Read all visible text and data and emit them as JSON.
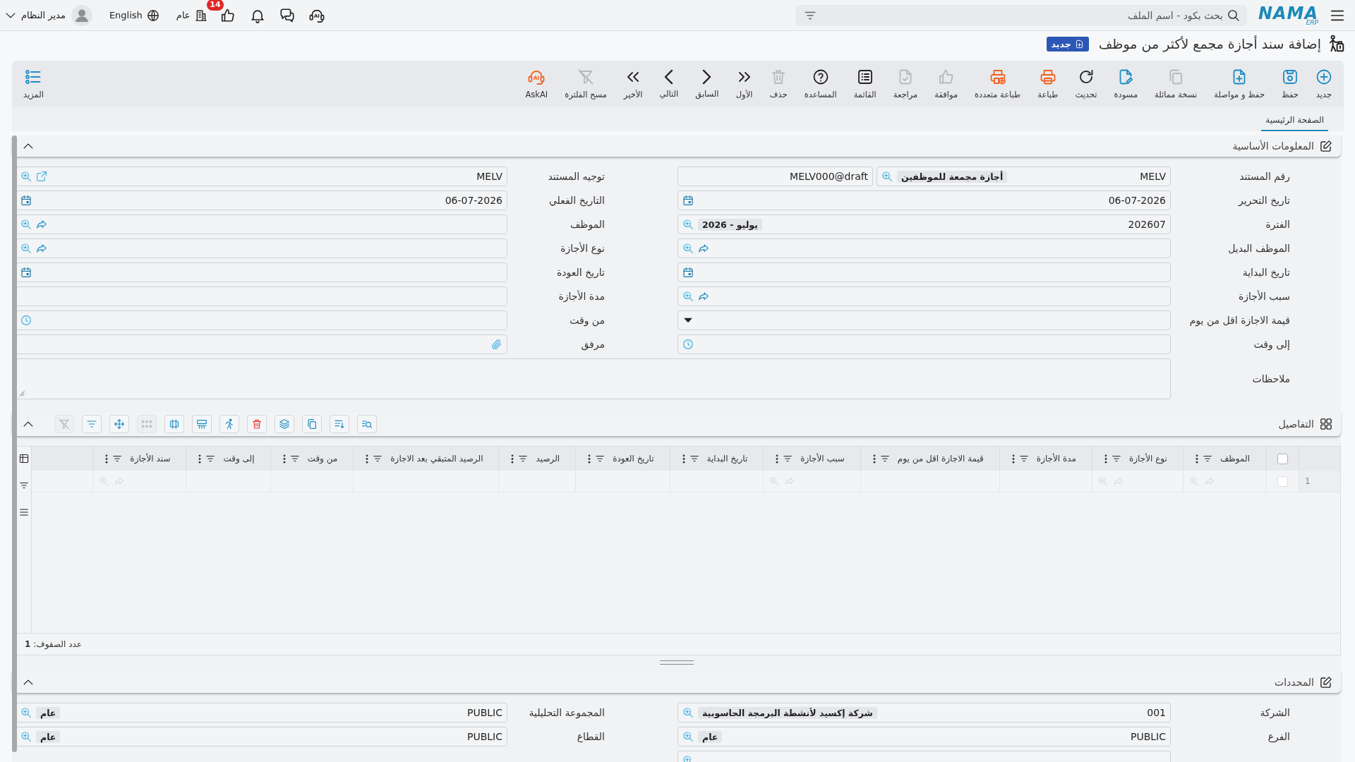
{
  "top_bar": {
    "logo": {
      "text": "NAMA",
      "sub": "ERP"
    },
    "search": {
      "placeholder": "بحث بكود - اسم الملف"
    },
    "assistant": "AI",
    "approvals_count": "14",
    "branch": "عام",
    "language": "English",
    "user": "مدير النظام"
  },
  "page_title": {
    "text": "إضافة سند أجازة مجمع لأكثر من موظف",
    "status": "جديد"
  },
  "toolbar": {
    "buttons": [
      {
        "kind": "new",
        "label": "جديد",
        "disabled": false
      },
      {
        "kind": "save",
        "label": "حفظ",
        "disabled": false
      },
      {
        "kind": "savecontinue",
        "label": "حفظ و مواصلة",
        "disabled": false
      },
      {
        "kind": "duplicate",
        "label": "نسخة مماثلة",
        "disabled": true
      },
      {
        "kind": "draft",
        "label": "مسودة",
        "disabled": false
      },
      {
        "kind": "refresh",
        "label": "تحديث",
        "disabled": false
      },
      {
        "kind": "print",
        "label": "طباعة",
        "disabled": false
      },
      {
        "kind": "multiprint",
        "label": "طباعة متعددة",
        "disabled": false
      },
      {
        "kind": "approve",
        "label": "موافقة",
        "disabled": true
      },
      {
        "kind": "review",
        "label": "مراجعة",
        "disabled": true
      },
      {
        "kind": "list",
        "label": "القائمة",
        "disabled": false
      },
      {
        "kind": "help",
        "label": "المساعدة",
        "disabled": false
      },
      {
        "kind": "delete",
        "label": "حذف",
        "disabled": true
      },
      {
        "kind": "first",
        "label": "الأول",
        "disabled": false
      },
      {
        "kind": "previous",
        "label": "السابق",
        "disabled": false
      },
      {
        "kind": "next",
        "label": "التالي",
        "disabled": false
      },
      {
        "kind": "last",
        "label": "الأخير",
        "disabled": false
      },
      {
        "kind": "clearfilter",
        "label": "مسح الفلترة",
        "disabled": true
      },
      {
        "kind": "askai",
        "label": "AskAI",
        "badge": "AI",
        "disabled": false
      }
    ],
    "more": "المزيد"
  },
  "tabs": [
    {
      "label": "الصفحة الرئيسية",
      "selected": true
    }
  ],
  "basic_info": {
    "title": "المعلومات الأساسية",
    "expanded": true,
    "fields": [
      {
        "label": "رقم المستند",
        "kind": "docnumber",
        "value": "MELV",
        "chip": "أجازة مجمعة للموظفين",
        "code": "MELV000@draft"
      },
      {
        "label": "توجيه المستند",
        "kind": "route",
        "value": "MELV"
      },
      {
        "label": "تاريخ التحرير",
        "kind": "date",
        "value": "06-07-2026"
      },
      {
        "label": "التاريخ الفعلي",
        "kind": "date",
        "value": "06-07-2026"
      },
      {
        "label": "الفترة",
        "kind": "lookup",
        "value": "202607",
        "chip": "يوليو - 2026"
      },
      {
        "label": "الموظف",
        "kind": "reference"
      },
      {
        "label": "الموظف البديل",
        "kind": "reference"
      },
      {
        "label": "نوع الأجازة",
        "kind": "reference"
      },
      {
        "label": "تاريخ البداية",
        "kind": "date"
      },
      {
        "label": "تاريخ العودة",
        "kind": "date"
      },
      {
        "label": "سبب الأجازة",
        "kind": "reference"
      },
      {
        "label": "مدة الأجازة",
        "kind": "text"
      },
      {
        "label": "قيمة الاجازة اقل من يوم",
        "kind": "select"
      },
      {
        "label": "من وقت",
        "kind": "time"
      },
      {
        "label": "إلى وقت",
        "kind": "time"
      },
      {
        "label": "مرفق",
        "kind": "attachment"
      },
      {
        "label": "ملاحظات",
        "kind": "textarea"
      }
    ]
  },
  "details": {
    "title": "التفاصيل",
    "expanded": true,
    "tools": [
      {
        "kind": "searchlist",
        "disabled": false
      },
      {
        "kind": "listarrow",
        "disabled": false
      },
      {
        "kind": "copy",
        "disabled": false
      },
      {
        "kind": "layers",
        "disabled": false
      },
      {
        "kind": "delete",
        "disabled": false
      },
      {
        "kind": "run",
        "disabled": false
      },
      {
        "kind": "rows",
        "disabled": false
      },
      {
        "kind": "columns",
        "disabled": false
      },
      {
        "kind": "dots",
        "disabled": true
      },
      {
        "kind": "move",
        "disabled": false
      },
      {
        "kind": "filter",
        "disabled": false
      },
      {
        "kind": "clearfilter",
        "disabled": true
      }
    ],
    "all_selected": false,
    "columns": [
      {
        "label": "الموظف",
        "kind": "reference"
      },
      {
        "label": "نوع الأجازة",
        "kind": "reference"
      },
      {
        "label": "مدة الأجازة",
        "kind": "text"
      },
      {
        "label": "قيمة الاجازة اقل من يوم",
        "kind": "text"
      },
      {
        "label": "سبب الأجازة",
        "kind": "reference"
      },
      {
        "label": "تاريخ البداية",
        "kind": "text"
      },
      {
        "label": "تاريخ العودة",
        "kind": "text"
      },
      {
        "label": "الرصيد",
        "kind": "text"
      },
      {
        "label": "الرصيد المتبقي بعد الاجازة",
        "kind": "text"
      },
      {
        "label": "من وقت",
        "kind": "text"
      },
      {
        "label": "إلى وقت",
        "kind": "text"
      },
      {
        "label": "سند الأجازة",
        "kind": "reference"
      }
    ],
    "rows": [
      {
        "number": "1",
        "checked": false
      }
    ],
    "footer": "عدد الصفوف: **1**"
  },
  "determinants": {
    "title": "المحددات",
    "expanded": true,
    "fields": [
      {
        "label": "الشركة",
        "kind": "lookup",
        "value": "001",
        "chip": "شركة إكسيد لأنشطة البرمجة الحاسوبية"
      },
      {
        "label": "المجموعة التحليلية",
        "kind": "lookup",
        "value": "PUBLIC",
        "chip": "عام"
      },
      {
        "label": "الفرع",
        "kind": "lookup",
        "value": "PUBLIC",
        "chip": "عام"
      },
      {
        "label": "القطاع",
        "kind": "lookup",
        "value": "PUBLIC",
        "chip": "عام"
      },
      {
        "kind": "lookup"
      }
    ]
  }
}
